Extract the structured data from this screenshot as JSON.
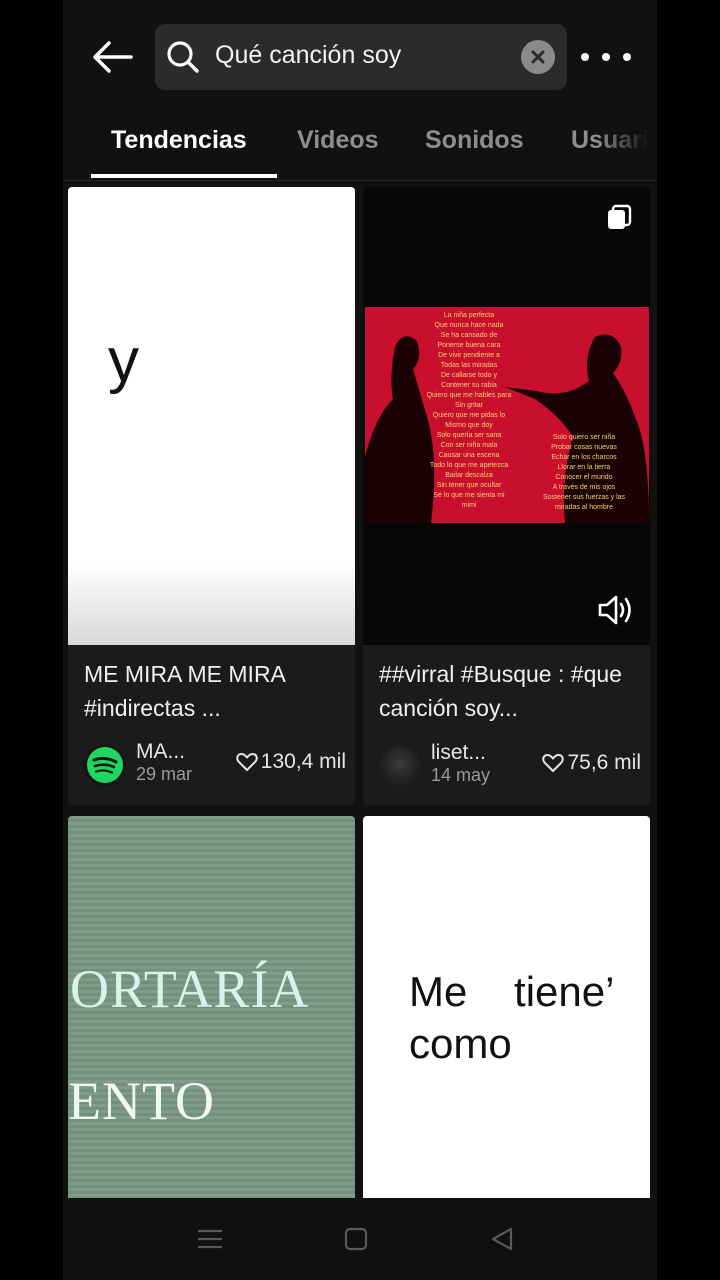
{
  "header": {
    "search_query": "Qué canción soy",
    "back_icon": "arrow-left-icon",
    "clear_icon": "close-circle-icon",
    "more_icon": "more-horizontal-icon"
  },
  "tabs": [
    {
      "label": "Tendencias",
      "active": true
    },
    {
      "label": "Videos",
      "active": false
    },
    {
      "label": "Sonidos",
      "active": false
    },
    {
      "label": "Usuari",
      "active": false
    }
  ],
  "results": [
    {
      "thumb_text": "y",
      "caption": "ME MIRA ME MIRA  #indirectas ...",
      "author": "MA...",
      "date": "29 mar",
      "likes": "130,4 mil",
      "avatar_icon": "spotify-logo-icon"
    },
    {
      "thumb_lyrics_left": [
        "La niña perfecta",
        "Que nunca hace nada",
        "Se ha cansado de",
        "Ponerse buena cara",
        "De vivir pendiente a",
        "Todas las miradas",
        "De callarse todo y",
        "Contener su rabia",
        "Quiero que me hables para",
        "Sin gritar",
        "Quiero que me pidas lo",
        "Mismo que doy",
        "Solo quería ser sana",
        "Con ser niña mala",
        "Causar una escena",
        "Todo lo que me apetezca",
        "Bailar descalza",
        "Sin tener que ocultar",
        "Sé lo que me sienta mi",
        "mimi"
      ],
      "thumb_lyrics_right": [
        "Solo quiero ser niña",
        "Probar cosas nuevas",
        "Echar en los charcos",
        "Llorar en la tierra",
        "Conocer el mundo",
        "A través de mis ojos",
        "Sostener sus fuerzas y las",
        "miradas al hombre"
      ],
      "caption": "##virral #Busque : #que canción soy...",
      "author": "liset...",
      "date": "14 may",
      "likes": "75,6 mil",
      "multi_icon": "photo-stack-icon",
      "sound_icon": "speaker-icon"
    },
    {
      "thumb_line1": "ORTARÍA",
      "thumb_line2": "ENTO"
    },
    {
      "thumb_line1": "Me    tiene’",
      "thumb_line2": "como"
    }
  ],
  "system_nav": {
    "menu_icon": "menu-lines-icon",
    "home_icon": "square-home-icon",
    "back_icon": "triangle-back-icon"
  },
  "colors": {
    "background": "#111111",
    "search_bg": "#2b2b2b",
    "lyrics_bg": "#c8102e",
    "lyrics_text": "#f5d36b",
    "teal_card": "#7a9a86"
  }
}
